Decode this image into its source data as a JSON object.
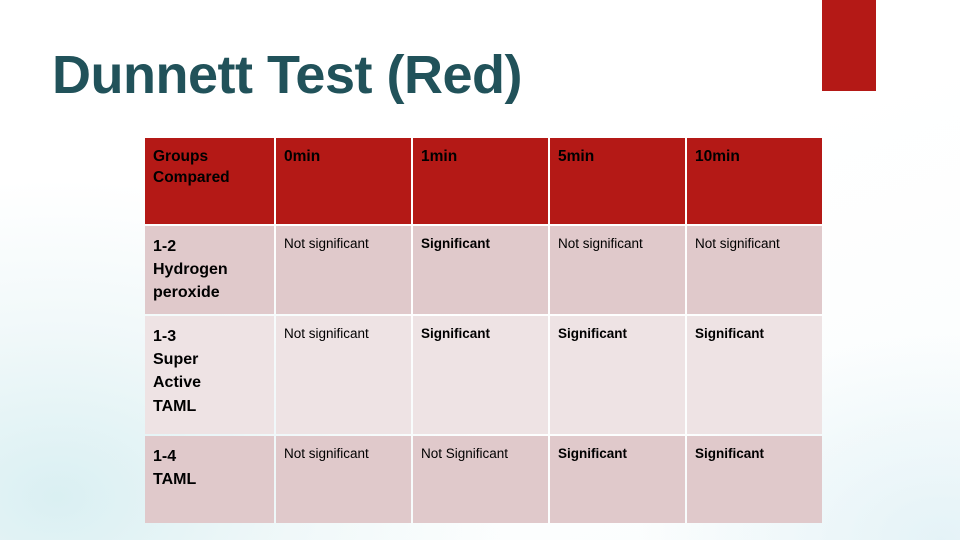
{
  "slide": {
    "title": "Dunnett Test (Red)",
    "title_color": "#21525a",
    "accent_color": "#b41916",
    "header_bg": "#b41916",
    "row_shade_dark": "#e0c9cb",
    "row_shade_light": "#eee3e4"
  },
  "table": {
    "headers": [
      "Groups Compared",
      "0min",
      "1min",
      "5min",
      "10min"
    ],
    "header_lines": {
      "col0_line1": "Groups",
      "col0_line2": "Compared"
    },
    "rows": [
      {
        "group_lines": [
          "1-2",
          "Hydrogen",
          "peroxide"
        ],
        "group_label": "1-2 Hydrogen peroxide",
        "cells": [
          {
            "text": "Not significant",
            "bold": false
          },
          {
            "text": "Significant",
            "bold": true
          },
          {
            "text": "Not significant",
            "bold": false
          },
          {
            "text": "Not significant",
            "bold": false
          }
        ]
      },
      {
        "group_lines": [
          "1-3",
          "Super",
          "Active",
          "TAML"
        ],
        "group_label": "1-3 Super Active TAML",
        "cells": [
          {
            "text": "Not significant",
            "bold": false
          },
          {
            "text": "Significant",
            "bold": true
          },
          {
            "text": "Significant",
            "bold": true
          },
          {
            "text": "Significant",
            "bold": true
          }
        ]
      },
      {
        "group_lines": [
          "1-4",
          "TAML"
        ],
        "group_label": "1-4 TAML",
        "cells": [
          {
            "text": "Not significant",
            "bold": false
          },
          {
            "text": "Not Significant",
            "bold": false
          },
          {
            "text": "Significant",
            "bold": true
          },
          {
            "text": "Significant",
            "bold": true
          }
        ]
      }
    ]
  }
}
